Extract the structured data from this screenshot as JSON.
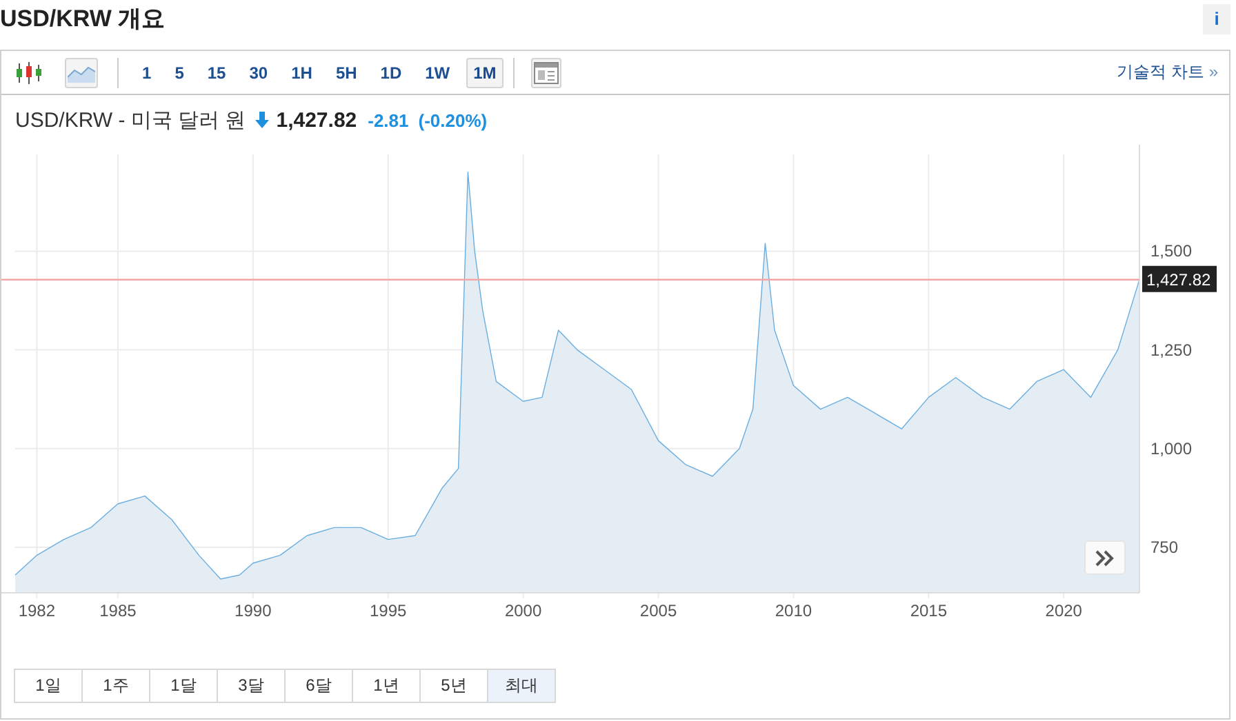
{
  "header": {
    "title": "USD/KRW 개요",
    "info": "i"
  },
  "toolbar": {
    "chart_types": [
      {
        "kind": "candlestick",
        "selected": false
      },
      {
        "kind": "area",
        "selected": true
      }
    ],
    "intervals": [
      {
        "label": "1",
        "selected": false
      },
      {
        "label": "5",
        "selected": false
      },
      {
        "label": "15",
        "selected": false
      },
      {
        "label": "30",
        "selected": false
      },
      {
        "label": "1H",
        "selected": false
      },
      {
        "label": "5H",
        "selected": false
      },
      {
        "label": "1D",
        "selected": false
      },
      {
        "label": "1W",
        "selected": false
      },
      {
        "label": "1M",
        "selected": true
      }
    ],
    "technical_link": {
      "label": "기술적 차트",
      "arrow": "»"
    }
  },
  "quote": {
    "name": "USD/KRW - 미국 달러 원",
    "falling": true,
    "price": "1,427.82",
    "change": "-2.81",
    "change_pct": "(-0.20%)"
  },
  "chart": {
    "chart_data": {
      "type": "area",
      "x": [
        1981.2,
        1982,
        1983,
        1984,
        1985,
        1986,
        1987,
        1988,
        1988.8,
        1989.5,
        1990,
        1991,
        1992,
        1993,
        1994,
        1995,
        1996,
        1997,
        1997.6,
        1997.95,
        1998.2,
        1998.5,
        1999,
        2000,
        2000.7,
        2001.3,
        2002,
        2003,
        2004,
        2005,
        2006,
        2007,
        2008,
        2008.5,
        2008.95,
        2009.3,
        2010,
        2011,
        2012,
        2013,
        2014,
        2015,
        2016,
        2017,
        2018,
        2019,
        2020,
        2021,
        2022,
        2022.8
      ],
      "series": [
        {
          "color": "#6aaee0",
          "values": [
            680,
            730,
            770,
            800,
            860,
            880,
            820,
            730,
            670,
            680,
            710,
            730,
            780,
            800,
            800,
            770,
            780,
            900,
            950,
            1700,
            1500,
            1350,
            1170,
            1120,
            1130,
            1300,
            1250,
            1200,
            1150,
            1020,
            960,
            930,
            1000,
            1100,
            1520,
            1300,
            1160,
            1100,
            1130,
            1090,
            1050,
            1130,
            1180,
            1130,
            1100,
            1170,
            1200,
            1130,
            1250,
            1428
          ]
        }
      ],
      "xlim": [
        1981.2,
        2022.8
      ],
      "ylim": [
        635,
        1745
      ],
      "xticks": [
        1982,
        1985,
        1990,
        1995,
        2000,
        2005,
        2010,
        2015,
        2020
      ],
      "yticks": [
        {
          "value": 750,
          "label": "750"
        },
        {
          "value": 1000,
          "label": "1,000"
        },
        {
          "value": 1250,
          "label": "1,250"
        },
        {
          "value": 1500,
          "label": "1,500"
        }
      ],
      "grid": true,
      "ref_lines": [
        {
          "axis": "y",
          "value": 1427.82,
          "label": "1,427.82"
        }
      ]
    }
  },
  "ranges": [
    {
      "label": "1일",
      "selected": false
    },
    {
      "label": "1주",
      "selected": false
    },
    {
      "label": "1달",
      "selected": false
    },
    {
      "label": "3달",
      "selected": false
    },
    {
      "label": "6달",
      "selected": false
    },
    {
      "label": "1년",
      "selected": false
    },
    {
      "label": "5년",
      "selected": false
    },
    {
      "label": "최대",
      "selected": true
    }
  ]
}
